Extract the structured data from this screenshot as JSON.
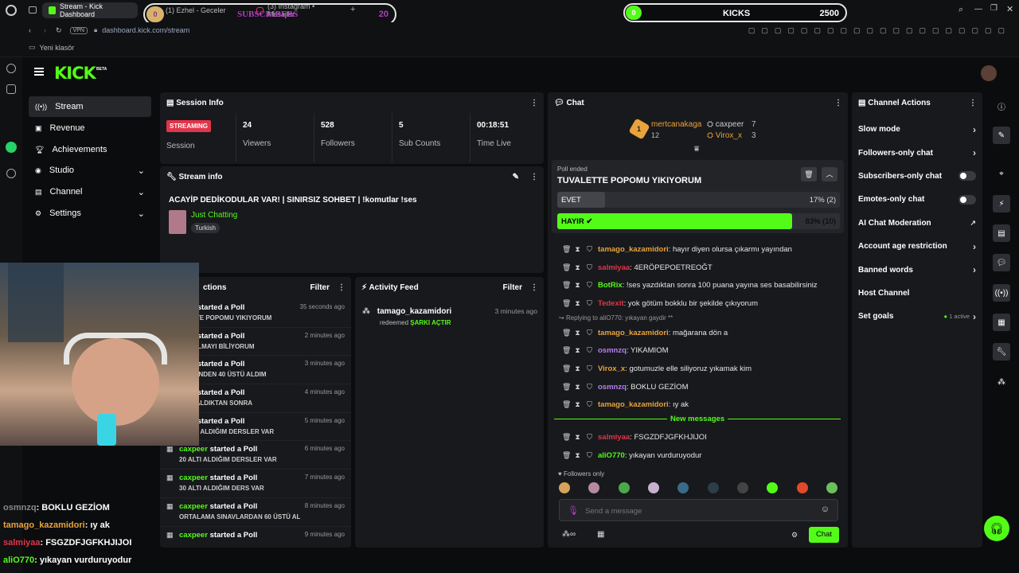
{
  "browser": {
    "tabs": [
      {
        "label": "Stream - Kick Dashboard",
        "active": true
      },
      {
        "label": "(1) Ezhel - Geceler"
      },
      {
        "label": "(3) Instagram • Mesajlar"
      }
    ],
    "new_tab": "+",
    "url_vpn": "VPN",
    "url": "dashboard.kick.com/stream",
    "bookmark": "Yeni klasör"
  },
  "overlays": {
    "subs_counter_left": "0",
    "subs_label": "SUBSCRIBERS",
    "subs_counter_right": "20",
    "kicks_left": "0",
    "kicks_label": "KICKS",
    "kicks_right": "2500"
  },
  "brand": {
    "logo": "KICK",
    "beta": "BETA"
  },
  "nav": {
    "items": [
      {
        "label": "Stream",
        "icon": "broadcast-icon",
        "active": true
      },
      {
        "label": "Revenue",
        "icon": "revenue-icon"
      },
      {
        "label": "Achievements",
        "icon": "trophy-icon"
      },
      {
        "label": "Studio",
        "icon": "studio-icon",
        "expand": "⌄"
      },
      {
        "label": "Channel",
        "icon": "channel-icon",
        "expand": "⌄"
      },
      {
        "label": "Settings",
        "icon": "gear-icon",
        "expand": "⌄"
      }
    ]
  },
  "session": {
    "title": "Session Info",
    "status_badge": "STREAMING",
    "status_label": "Session",
    "stats": [
      {
        "value": "24",
        "label": "Viewers"
      },
      {
        "value": "528",
        "label": "Followers"
      },
      {
        "value": "5",
        "label": "Sub Counts"
      },
      {
        "value": "00:18:51",
        "label": "Time Live"
      }
    ]
  },
  "stream_info": {
    "title": "Stream info",
    "stream_title": "ACAYİP DEDİKODULAR VAR! | SINIRSIZ SOHBET | !komutlar !ses",
    "category": "Just Chatting",
    "tag": "Turkish"
  },
  "actions": {
    "title": "ctions",
    "filter": "Filter",
    "rows": [
      {
        "user": "peer",
        "action": "started a Poll",
        "time": "35 seconds ago",
        "detail": "ALETTE POPOMU YIKIYORUM"
      },
      {
        "user": "peer",
        "action": "started a Poll",
        "time": "2 minutes ago",
        "detail": "EST ALMAYI BİLİYORUM"
      },
      {
        "user": "peer",
        "action": "started a Poll",
        "time": "3 minutes ago",
        "detail": "DERSİNDEN 40 ÜSTÜ ALDIM"
      },
      {
        "user": "peer",
        "action": "started a Poll",
        "time": "4 minutes ago",
        "detail": "NEYİ ALDIKTAN SONRA"
      },
      {
        "user": "peer",
        "action": "started a Poll",
        "time": "5 minutes ago",
        "detail": "E ALTI ALDIĞIM DERSLER VAR"
      },
      {
        "user": "caxpeer",
        "action": "started a Poll",
        "time": "6 minutes ago",
        "detail": "20 ALTI ALDIĞIM DERSLER VAR"
      },
      {
        "user": "caxpeer",
        "action": "started a Poll",
        "time": "7 minutes ago",
        "detail": "30 ALTI ALDIĞIM DERS VAR"
      },
      {
        "user": "caxpeer",
        "action": "started a Poll",
        "time": "8 minutes ago",
        "detail": "ORTALAMA SINAVLARDAN 60 ÜSTÜ ALDIM"
      },
      {
        "user": "caxpeer",
        "action": "started a Poll",
        "time": "9 minutes ago",
        "detail": ""
      }
    ]
  },
  "activity": {
    "title": "Activity Feed",
    "filter": "Filter",
    "item": {
      "user": "tamago_kazamidori",
      "time": "3 minutes ago",
      "text": "redeemed",
      "reward": "ŞARKI AÇTIR"
    }
  },
  "chat": {
    "title": "Chat",
    "top": {
      "rank1": "1",
      "user1": "mertcanakaga",
      "count1": "12",
      "user2": "caxpeer",
      "count2": "7",
      "user3": "Virox_x",
      "count3": "3"
    },
    "poll": {
      "status": "Poll ended",
      "question": "TUVALETTE POPOMU YIKIYORUM",
      "options": [
        {
          "label": "EVET",
          "result": "17% (2)",
          "percent": 17,
          "winner": false
        },
        {
          "label": "HAYIR",
          "result": "83% (10)",
          "percent": 83,
          "winner": true
        }
      ]
    },
    "messages": [
      {
        "user": "tamago_kazamidori",
        "color": "#e8a33d",
        "text": "hayır diyen olursa çıkarmı yayından"
      },
      {
        "user": "salmiyaa",
        "color": "#e0354a",
        "text": "4ERÖPEPOETREOĞT"
      },
      {
        "user": "BotRix",
        "color": "#53fc18",
        "text": "!ses yazdıktan sonra 100 puana yayına ses basabilirsiniz"
      },
      {
        "user": "Tedexit",
        "color": "#e0354a",
        "text": "yok götüm bokklu bir şekilde çıkıyorum"
      },
      {
        "reply": "Replying to aliO770: yıkayan gaydir **"
      },
      {
        "user": "tamago_kazamidori",
        "color": "#e8a33d",
        "text": "mağarana dön a"
      },
      {
        "user": "osmnzq",
        "color": "#b77ef0",
        "text": "YIKAMIOM"
      },
      {
        "user": "Virox_x",
        "color": "#e8a33d",
        "text": "gotumuzle elle siliyoruz yıkamak kim"
      },
      {
        "user": "osmnzq",
        "color": "#b77ef0",
        "text": "BOKLU GEZİOM"
      },
      {
        "user": "tamago_kazamidori",
        "color": "#e8a33d",
        "text": "ıy ak"
      }
    ],
    "new_messages": "New messages",
    "new": [
      {
        "user": "salmiyaa",
        "color": "#e0354a",
        "text": "FSGZDFJGFKHJIJOI"
      },
      {
        "user": "aliO770",
        "color": "#53fc18",
        "text": "yıkayan vurduruyodur"
      }
    ],
    "followers_only": "Followers only",
    "input_placeholder": "Send a message",
    "send": "Chat"
  },
  "channel_actions": {
    "title": "Channel Actions",
    "rows": [
      {
        "label": "Slow mode",
        "control": "chevron"
      },
      {
        "label": "Followers-only chat",
        "control": "chevron"
      },
      {
        "label": "Subscribers-only chat",
        "control": "toggle"
      },
      {
        "label": "Emotes-only chat",
        "control": "toggle"
      },
      {
        "label": "AI Chat Moderation",
        "control": "external"
      },
      {
        "label": "Account age restriction",
        "control": "chevron"
      },
      {
        "label": "Banned words",
        "control": "chevron"
      },
      {
        "label": "Host Channel",
        "control": "none"
      },
      {
        "label": "Set goals",
        "control": "chevron",
        "extra": "1 active"
      }
    ]
  },
  "stream_overlay_chat": [
    {
      "user": "osmnzq",
      "color": "#888888",
      "text": ": BOKLU GEZİOM"
    },
    {
      "user": "tamago_kazamidori",
      "color": "#e8a33d",
      "text": ": ıy ak"
    },
    {
      "user": "salmiyaa",
      "color": "#e0354a",
      "text": ": FSGZDFJGFKHJIJOI"
    },
    {
      "user": "aliO770",
      "color": "#53fc18",
      "text": ": yıkayan vurduruyodur"
    }
  ],
  "colors": {
    "accent": "#53fc18",
    "panel": "#18191c",
    "bg": "#0b0c0d",
    "streaming": "#e0354a"
  }
}
